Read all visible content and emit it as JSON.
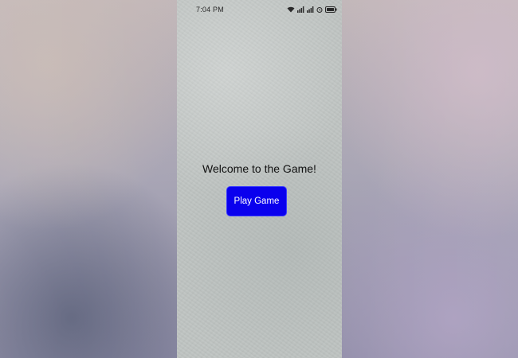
{
  "status_bar": {
    "time": "7:04 PM",
    "icons": [
      "wifi-icon",
      "signal-icon",
      "signal-icon",
      "alarm-icon",
      "battery-icon"
    ]
  },
  "main": {
    "welcome_text": "Welcome to the Game!",
    "play_button_label": "Play Game"
  },
  "colors": {
    "button_background": "#0a00ee",
    "button_text": "#ffffff",
    "page_background": "#bfc4c2"
  }
}
